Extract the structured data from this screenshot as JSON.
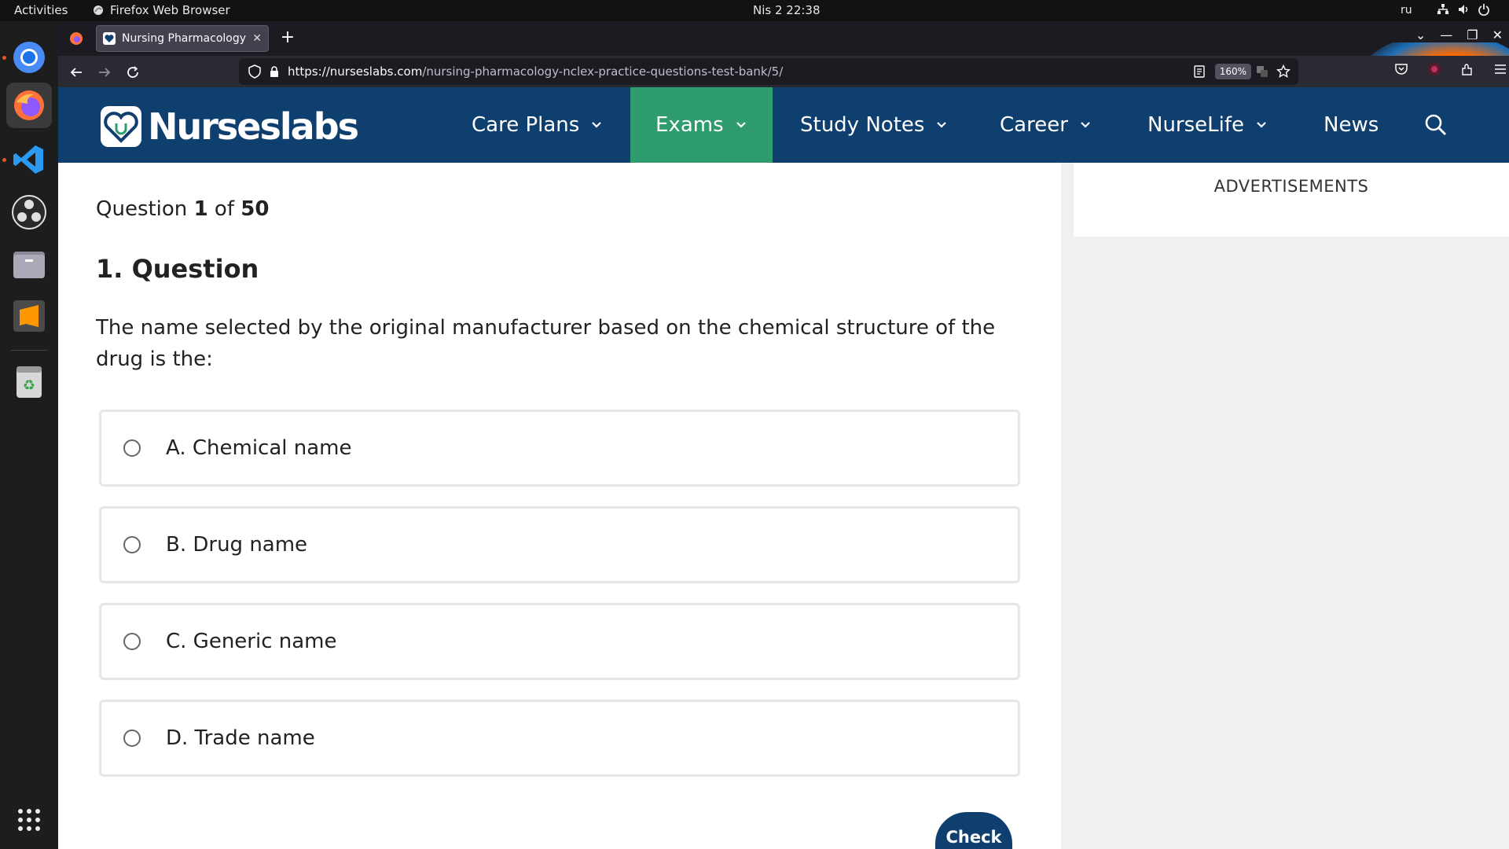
{
  "system": {
    "activities": "Activities",
    "app_name": "Firefox Web Browser",
    "clock": "Nis 2  22:38",
    "lang": "ru"
  },
  "browser": {
    "tab_title": "Nursing Pharmacology Q",
    "url_host": "https://nurseslabs.com",
    "url_path": "/nursing-pharmacology-nclex-practice-questions-test-bank/5/",
    "zoom": "160%"
  },
  "site": {
    "logo": "Nurseslabs",
    "nav": [
      {
        "label": "Care Plans"
      },
      {
        "label": "Exams"
      },
      {
        "label": "Study Notes"
      },
      {
        "label": "Career"
      },
      {
        "label": "NurseLife"
      },
      {
        "label": "News"
      }
    ]
  },
  "quiz": {
    "counter_prefix": "Question ",
    "counter_current": "1",
    "counter_mid": " of ",
    "counter_total": "50",
    "title": "1. Question",
    "text": "The name selected by the original manufacturer based on the chemical structure of the drug is the:",
    "answers": [
      {
        "label": "A. Chemical name"
      },
      {
        "label": "B. Drug name"
      },
      {
        "label": "C. Generic name"
      },
      {
        "label": "D. Trade name"
      }
    ],
    "check_label": "Check"
  },
  "sidebar": {
    "ad_label": "ADVERTISEMENTS"
  },
  "colors": {
    "header_bg": "#0e3f6e",
    "nav_active": "#2e9c6c"
  }
}
